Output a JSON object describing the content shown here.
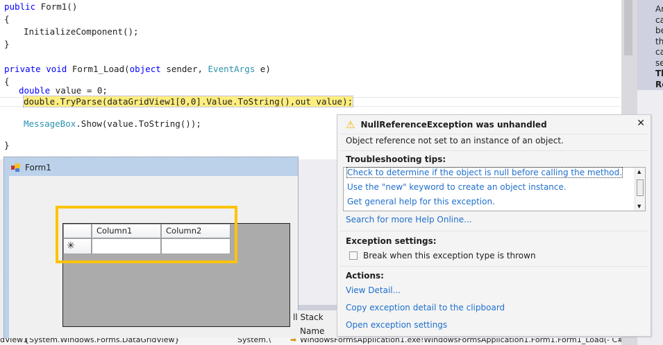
{
  "editor": {
    "lines": {
      "l1": "public Form1()",
      "l2": "{",
      "l3": "InitializeComponent();",
      "l4": "}",
      "l5a": "private void ",
      "l5b": "Form1_Load(",
      "l5c": "object",
      "l5d": " sender, ",
      "l5e": "EventArgs",
      "l5f": " e)",
      "l6": "{",
      "l7a": "double",
      "l7b": " value = 0;",
      "l8": "double.TryParse(dataGridView1[0,0].Value.ToString(),out value);",
      "l9a": "MessageBox",
      "l9b": ".Show(value.ToString());",
      "l10": "}"
    },
    "kw_public": "public"
  },
  "right_panel": {
    "lines": [
      "An",
      "ca",
      "be",
      "th",
      "ca",
      "se",
      "Th",
      "Re"
    ]
  },
  "form": {
    "title": "Form1",
    "grid": {
      "columns": [
        "Column1",
        "Column2"
      ],
      "new_row_marker": "✳"
    }
  },
  "callstack": {
    "title": "ll Stack",
    "column": "Name"
  },
  "bottom": {
    "left": "dView1",
    "value": "{System.Windows.Forms.DataGridView}",
    "type": "System.\\",
    "frame": "WindowsFormsApplication1.exe!WindowsFormsApplication1.Form1.Form1_Load(- C#"
  },
  "popup": {
    "title": "NullReferenceException was unhandled",
    "message": "Object reference not set to an instance of an object.",
    "tips_heading": "Troubleshooting tips:",
    "tips": [
      "Check to determine if the object is null before calling the method.",
      "Use the \"new\" keyword to create an object instance.",
      "Get general help for this exception."
    ],
    "search_link": "Search for more Help Online...",
    "settings_heading": "Exception settings:",
    "break_checkbox": {
      "label": "Break when this exception type is thrown",
      "checked": false
    },
    "actions_heading": "Actions:",
    "actions": [
      "View Detail...",
      "Copy exception detail to the clipboard",
      "Open exception settings"
    ]
  },
  "colors": {
    "highlight_border": "#fcc30b",
    "link": "#1e6fcc",
    "current_statement": "#ffee80"
  }
}
